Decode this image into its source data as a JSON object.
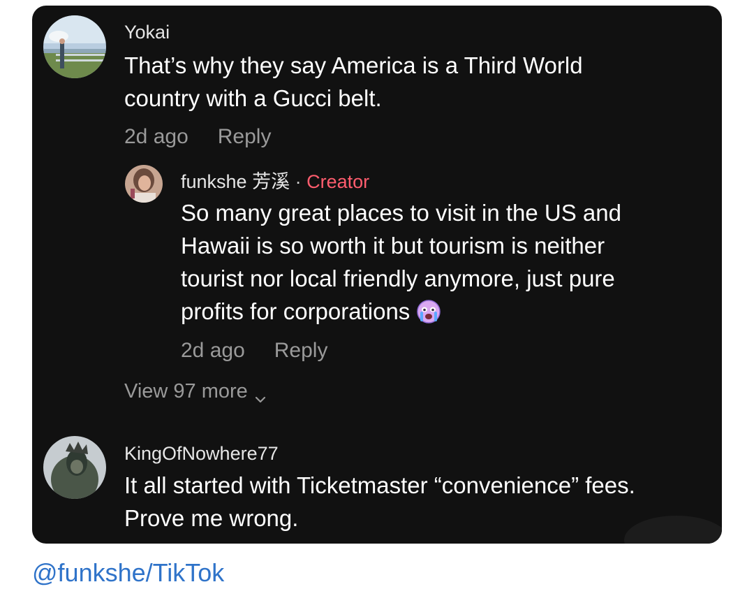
{
  "comments": [
    {
      "username": "Yokai",
      "lines": [
        "That’s why they say America is a Third World",
        "country with a Gucci belt."
      ],
      "time": "2d ago",
      "reply_label": "Reply",
      "avatar_icon": "user-photo-avatar"
    },
    {
      "username": "funkshe 芳溪",
      "separator": " · ",
      "badge": "Creator",
      "lines": [
        "So many great places to visit in the US and",
        "Hawaii is so worth it but tourism is neither",
        "tourist nor local friendly anymore, just pure",
        "profits for corporations"
      ],
      "emoji_icon": "crying-face-emoji",
      "time": "2d ago",
      "reply_label": "Reply",
      "avatar_icon": "user-photo-avatar"
    },
    {
      "username": "KingOfNowhere77",
      "lines": [
        "It all started with Ticketmaster “convenience” fees.",
        "Prove me wrong."
      ],
      "avatar_icon": "user-photo-avatar"
    }
  ],
  "view_more_label": "View 97 more",
  "credit": "@funkshe/TikTok",
  "colors": {
    "card_bg": "#111111",
    "creator_badge": "#ff5d6e",
    "link": "#2f73c9"
  }
}
